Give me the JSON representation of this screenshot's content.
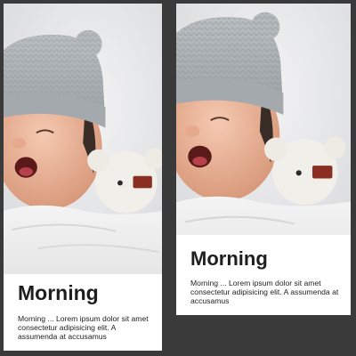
{
  "cards": [
    {
      "title": "Morning",
      "text": "Morning ... Lorem ipsum dolor sit amet consectetur adipisicing elit. A assumenda at accusamus",
      "image": "yawning-baby-photo"
    },
    {
      "title": "Morning",
      "text": "Morning ... Lorem ipsum dolor sit amet consectetur adipisicing elit. A assumenda at accusamus",
      "image": "yawning-baby-photo"
    }
  ]
}
